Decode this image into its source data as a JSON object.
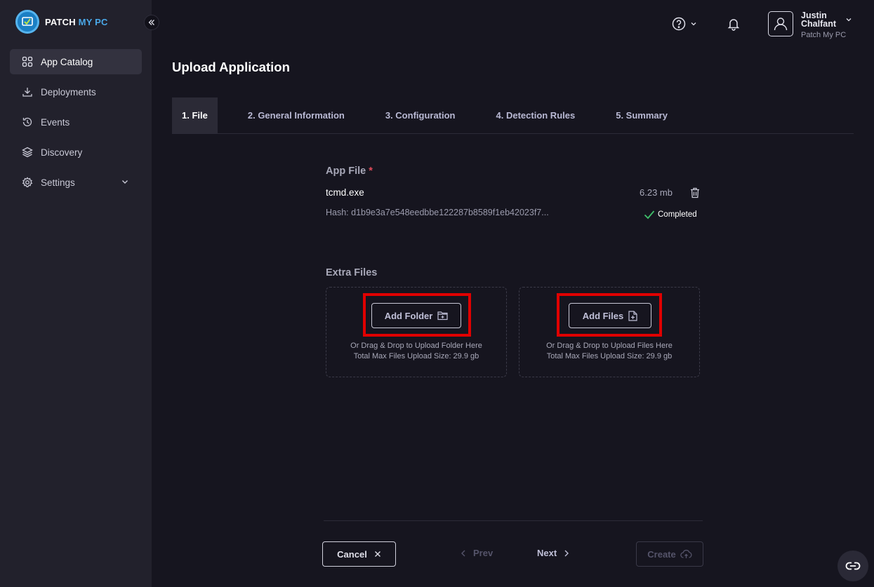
{
  "brand": {
    "name_a": "PATCH",
    "name_b": "MY PC"
  },
  "sidebar": {
    "items": [
      {
        "label": "App Catalog",
        "icon": "grid-icon",
        "active": true
      },
      {
        "label": "Deployments",
        "icon": "download-icon"
      },
      {
        "label": "Events",
        "icon": "history-icon"
      },
      {
        "label": "Discovery",
        "icon": "layers-icon"
      },
      {
        "label": "Settings",
        "icon": "gear-icon"
      }
    ]
  },
  "header": {
    "user_name": "Justin Chalfant",
    "user_org": "Patch My PC"
  },
  "page": {
    "title": "Upload Application"
  },
  "tabs": [
    {
      "label": "1. File",
      "active": true
    },
    {
      "label": "2. General Information"
    },
    {
      "label": "3. Configuration"
    },
    {
      "label": "4. Detection Rules"
    },
    {
      "label": "5. Summary"
    }
  ],
  "app_file": {
    "label": "App File",
    "required_mark": "*",
    "file_name": "tcmd.exe",
    "file_size": "6.23 mb",
    "hash": "Hash: d1b9e3a7e548eedbbe122287b8589f1eb42023f7...",
    "status": "Completed"
  },
  "extra_files": {
    "label": "Extra Files",
    "folder": {
      "button_label": "Add Folder",
      "hint_line1": "Or Drag & Drop to Upload Folder Here",
      "hint_line2": "Total Max Files Upload Size: 29.9 gb"
    },
    "files": {
      "button_label": "Add Files",
      "hint_line1": "Or Drag & Drop to Upload Files Here",
      "hint_line2": "Total Max Files Upload Size: 29.9 gb"
    }
  },
  "footer": {
    "cancel": "Cancel",
    "prev": "Prev",
    "next": "Next",
    "create": "Create"
  },
  "colors": {
    "background": "#16151f",
    "sidebar": "#22212c",
    "highlight": "#e00000",
    "success": "#3fbf6a",
    "required": "#e04b5a"
  }
}
